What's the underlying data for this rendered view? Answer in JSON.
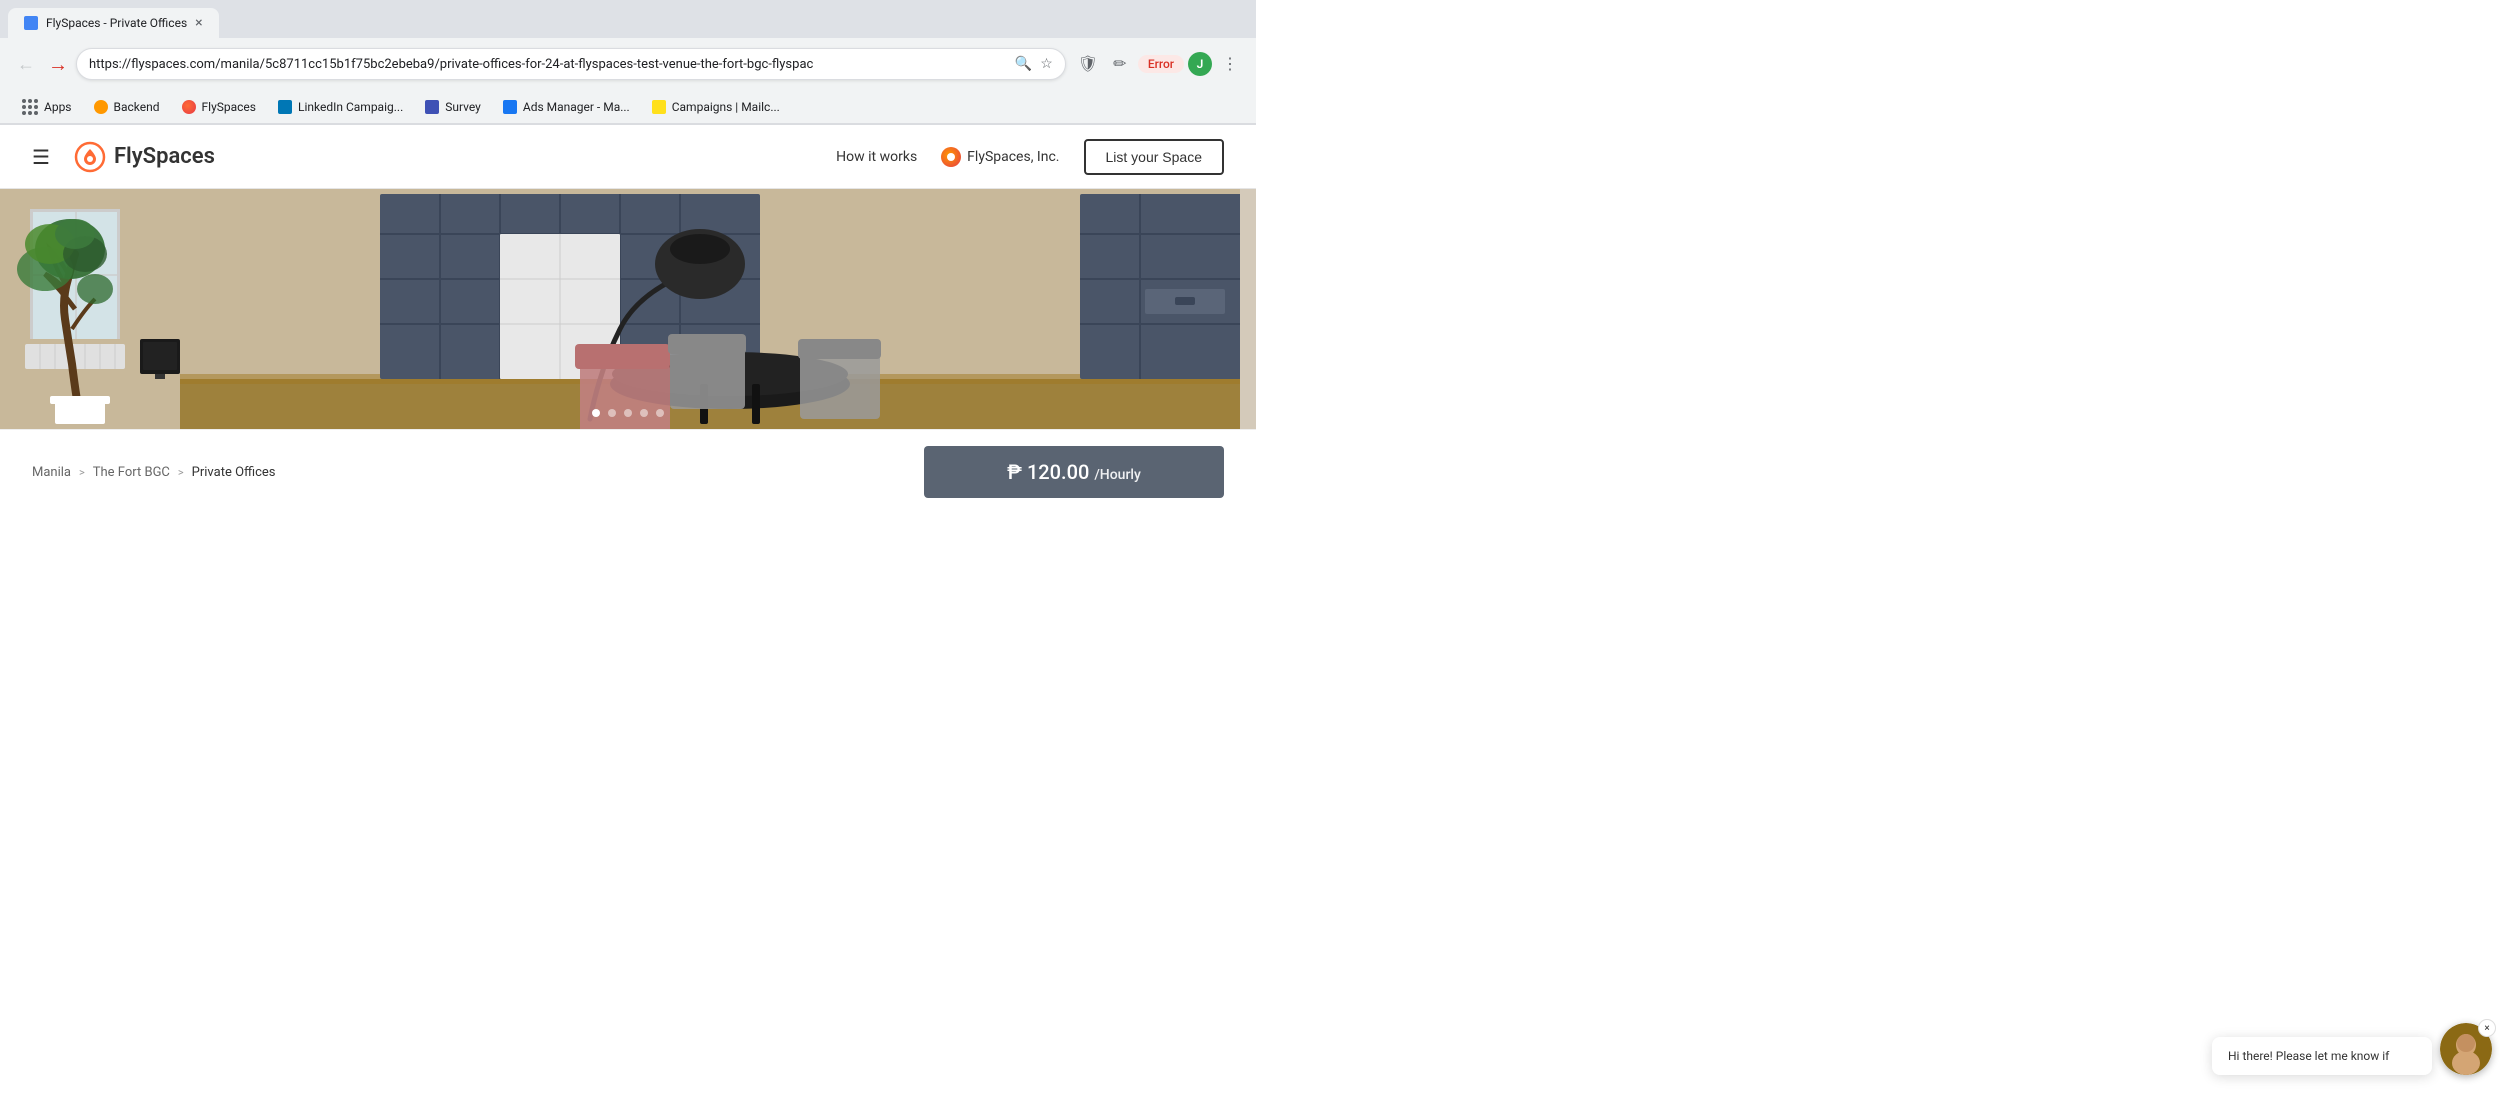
{
  "browser": {
    "tab": {
      "title": "FlySpaces - Private Offices",
      "favicon_color": "#4285f4"
    },
    "address": {
      "url": "https://flyspaces.com/manila/5c8711cc15b1f75bc2ebeba9/private-offices-for-24-at-flyspaces-test-venue-the-fort-bgc-flyspac",
      "error_label": "Error"
    },
    "bookmarks": [
      {
        "id": "apps",
        "label": "Apps",
        "has_grid_icon": true
      },
      {
        "id": "backend",
        "label": "Backend",
        "favicon_color": "#ff9800"
      },
      {
        "id": "flyspaces",
        "label": "FlySpaces",
        "favicon_color": "#e63946"
      },
      {
        "id": "linkedin",
        "label": "LinkedIn Campaig...",
        "favicon_color": "#0077b5"
      },
      {
        "id": "survey",
        "label": "Survey",
        "favicon_color": "#3f51b5"
      },
      {
        "id": "ads-manager",
        "label": "Ads Manager - Ma...",
        "favicon_color": "#1877f2"
      },
      {
        "id": "campaigns",
        "label": "Campaigns | Mailc...",
        "favicon_color": "#ffe01b"
      }
    ]
  },
  "site": {
    "logo_text": "FlySpaces",
    "nav": {
      "how_it_works": "How it works",
      "company": "FlySpaces, Inc.",
      "list_space_btn": "List your Space"
    },
    "hero": {
      "carousel_dots": [
        {
          "active": true
        },
        {
          "active": false
        },
        {
          "active": false
        },
        {
          "active": false
        },
        {
          "active": false
        }
      ]
    },
    "breadcrumb": {
      "items": [
        {
          "label": "Manila",
          "link": true
        },
        {
          "label": "The Fort BGC",
          "link": true
        },
        {
          "label": "Private Offices",
          "link": false
        }
      ],
      "separators": [
        ">",
        ">"
      ]
    },
    "price": {
      "symbol": "₱",
      "amount": "120.00",
      "unit": "/Hourly"
    },
    "chat": {
      "preview_text": "Hi there! Please let me know if"
    }
  },
  "icons": {
    "back": "←",
    "forward": "→",
    "refresh": "↻",
    "search": "🔍",
    "star": "☆",
    "more": "⋮",
    "hamburger": "☰",
    "location_pin": "📍",
    "close": "×"
  }
}
